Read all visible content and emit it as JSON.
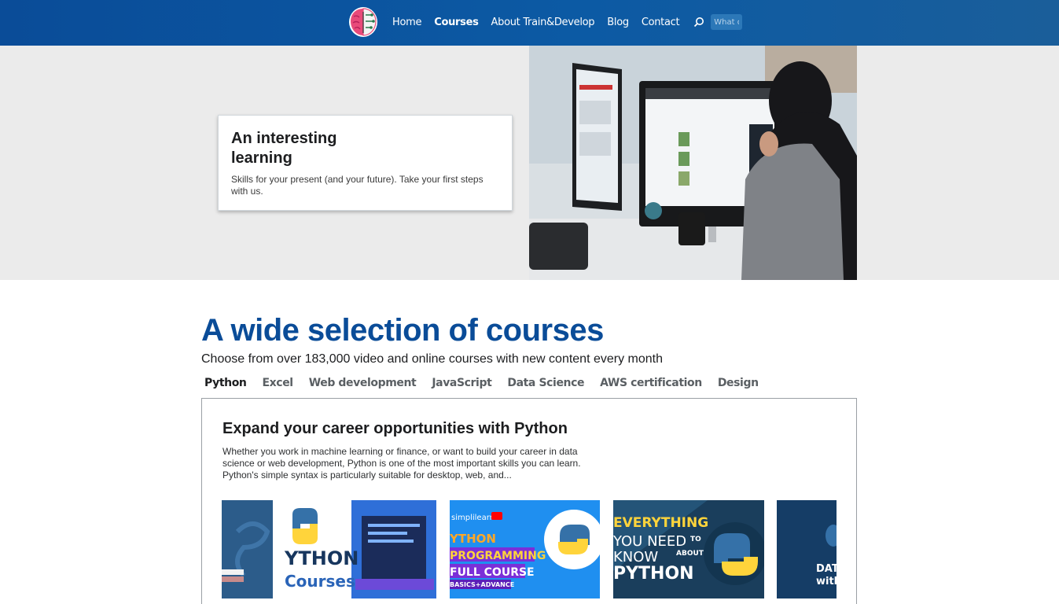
{
  "nav": {
    "items": [
      {
        "label": "Home",
        "active": false
      },
      {
        "label": "Courses",
        "active": true
      },
      {
        "label": "About Train&Develop",
        "active": false
      },
      {
        "label": "Blog",
        "active": false
      },
      {
        "label": "Contact",
        "active": false
      }
    ],
    "search_placeholder": "What do",
    "logo_icon": "brain-logo",
    "colors": {
      "bar": "#0a4c98",
      "accent": "#e84a7a"
    }
  },
  "hero": {
    "title": "An interesting learning",
    "subtitle": "Skills for your present (and your future). Take your first steps with us."
  },
  "courses": {
    "title": "A wide selection of courses",
    "subtitle": "Choose from over 183,000 video and online courses with new content every month",
    "tabs": [
      "Python",
      "Excel",
      "Web development",
      "JavaScript",
      "Data Science",
      "AWS certification",
      "Design"
    ],
    "active_tab": "Python",
    "panel": {
      "title": "Expand your career opportunities with Python",
      "description": "Whether you work in machine learning or finance, or want to build your career in data science or web development, Python is one of the most important skills you can learn. Python's simple syntax is particularly suitable for desktop, web, and..."
    },
    "thumbnails": [
      {
        "text_lines": [
          "YTHON",
          "Courses"
        ]
      },
      {
        "text_lines": [
          "simplilearn",
          "YTHON",
          "PROGRAMMING",
          "FULL COURSE",
          "BASICS+ADVANCE"
        ]
      },
      {
        "text_lines": [
          "EVERYTHING",
          "YOU NEED",
          "TO",
          "KNOW",
          "ABOUT",
          "PYTHON"
        ]
      },
      {
        "text_lines": [
          "DAT",
          "with"
        ]
      }
    ]
  }
}
